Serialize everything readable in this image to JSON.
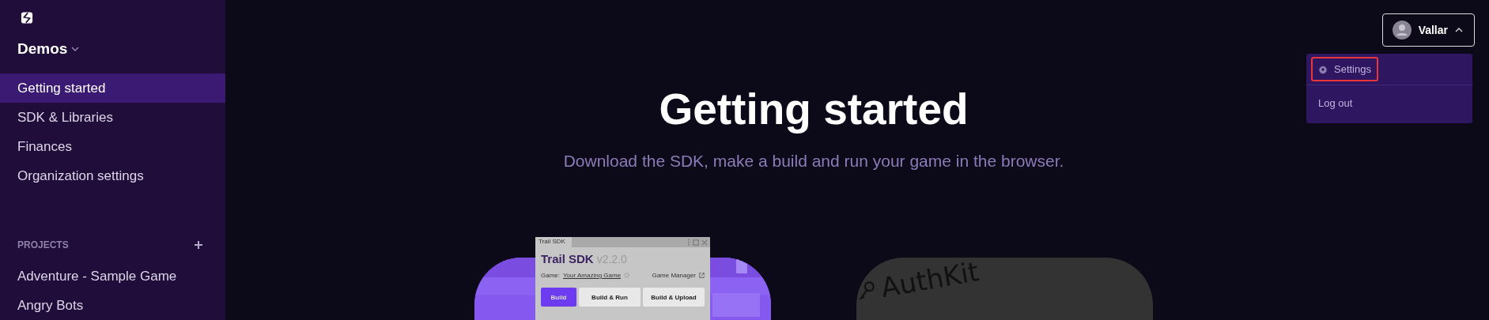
{
  "sidebar": {
    "org": "Demos",
    "nav": [
      {
        "label": "Getting started",
        "selected": true
      },
      {
        "label": "SDK & Libraries",
        "selected": false
      },
      {
        "label": "Finances",
        "selected": false
      },
      {
        "label": "Organization settings",
        "selected": false
      }
    ],
    "projects_heading": "PROJECTS",
    "projects": [
      {
        "label": "Adventure - Sample Game",
        "selected": false
      },
      {
        "label": "Angry Bots",
        "selected": false
      }
    ]
  },
  "user_menu": {
    "name": "Vallar",
    "expanded": true,
    "items": [
      {
        "label": "Settings",
        "kind": "settings",
        "highlighted": true
      },
      {
        "label": "Log out",
        "kind": "plain",
        "highlighted": false
      }
    ]
  },
  "header": {
    "title": "Getting started",
    "subtitle": "Download the SDK, make a build and run your game in the browser."
  },
  "cards": [
    {
      "kind": "sdk",
      "window_tab": "Trail SDK",
      "app_title": "Trail SDK",
      "version": "v2.2.0",
      "game_label": "Game:",
      "game_value": "Your Amazing Game",
      "manager_link": "Game Manager",
      "buttons": [
        {
          "label": "Build",
          "primary": true
        },
        {
          "label": "Build & Run",
          "primary": false
        },
        {
          "label": "Build & Upload",
          "primary": false
        }
      ]
    },
    {
      "kind": "authkit",
      "title": "AuthKit"
    }
  ]
}
